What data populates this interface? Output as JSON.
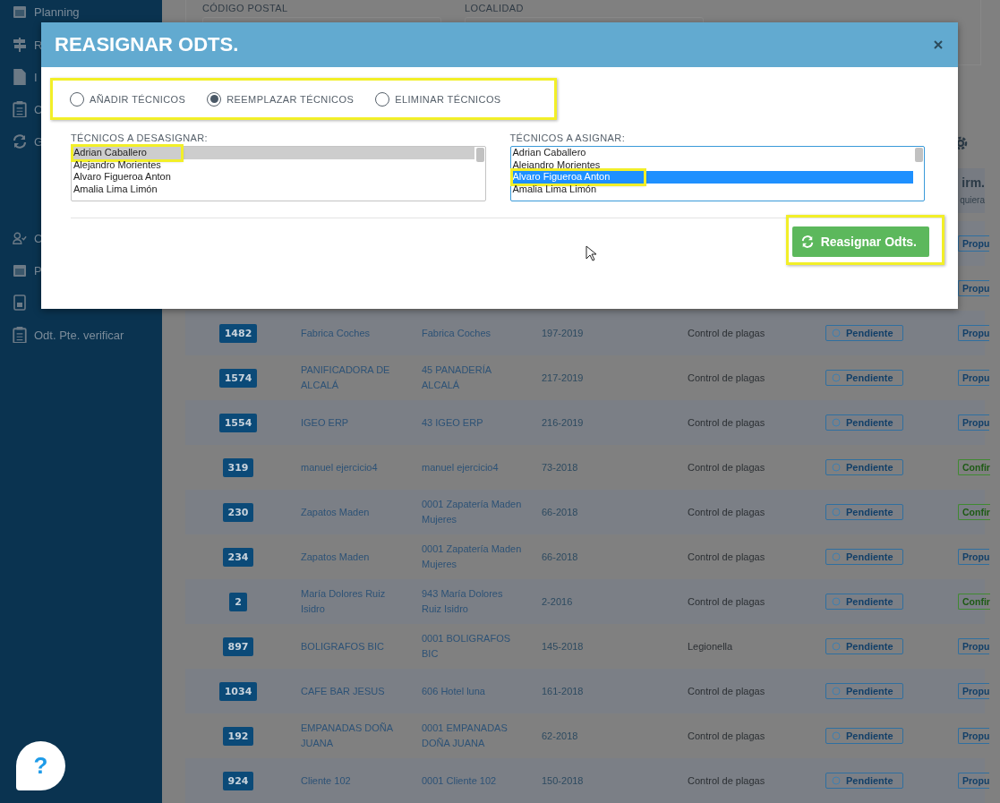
{
  "sidebar": {
    "items": [
      {
        "label": "Planning"
      },
      {
        "label": "R"
      },
      {
        "label": "I"
      },
      {
        "label": "C"
      },
      {
        "label": "G"
      },
      {
        "label": "C"
      },
      {
        "label": "P"
      },
      {
        "label": "Odt. Pte. verificar"
      }
    ]
  },
  "filters": {
    "fields": [
      {
        "label": "CÓDIGO POSTAL"
      },
      {
        "label": "LOCALIDAD"
      }
    ]
  },
  "table": {
    "header": {
      "label": "irm.",
      "hint": "quiera"
    },
    "partial_rows": [
      {
        "tag": {
          "text": "Propu",
          "kind": "proposed"
        }
      },
      {
        "tag": {
          "text": "Propu",
          "kind": "proposed"
        }
      }
    ],
    "rows": [
      {
        "id": "1482",
        "client": "Fabrica Coches",
        "address": "Fabrica Coches",
        "number": "197-2019",
        "service": "Control de plagas",
        "status": "Pendiente",
        "tag": {
          "text": "Propu",
          "kind": "proposed"
        }
      },
      {
        "id": "1574",
        "client": "PANIFICADORA DE ALCALÁ",
        "address": "45 PANADERÍA ALCALÁ",
        "number": "217-2019",
        "service": "Control de plagas",
        "status": "Pendiente",
        "tag": {
          "text": "Propu",
          "kind": "proposed"
        }
      },
      {
        "id": "1554",
        "client": "IGEO ERP",
        "address": "43 IGEO ERP",
        "number": "216-2019",
        "service": "Control de plagas",
        "status": "Pendiente",
        "tag": {
          "text": "Propu",
          "kind": "proposed"
        }
      },
      {
        "id": "319",
        "client": "manuel ejercicio4",
        "address": "manuel ejercicio4",
        "number": "73-2018",
        "service": "Control de plagas",
        "status": "Pendiente",
        "tag": {
          "text": "Confir",
          "kind": "confirmed"
        }
      },
      {
        "id": "230",
        "client": "Zapatos Maden",
        "address": "0001 Zapatería Maden Mujeres",
        "number": "66-2018",
        "service": "Control de plagas",
        "status": "Pendiente",
        "tag": {
          "text": "Confir",
          "kind": "confirmed"
        }
      },
      {
        "id": "234",
        "client": "Zapatos Maden",
        "address": "0001 Zapatería Maden Mujeres",
        "number": "66-2018",
        "service": "Control de plagas",
        "status": "Pendiente",
        "tag": {
          "text": "Propu",
          "kind": "proposed"
        }
      },
      {
        "id": "2",
        "client": "María Dolores Ruiz Isidro",
        "address": "943 María Dolores Ruiz Isidro",
        "number": "2-2016",
        "service": "Control de plagas",
        "status": "Pendiente",
        "tag": {
          "text": "Confir",
          "kind": "confirmed"
        }
      },
      {
        "id": "897",
        "client": "BOLIGRAFOS BIC",
        "address": "0001 BOLIGRAFOS BIC",
        "number": "145-2018",
        "service": "Legionella",
        "status": "Pendiente",
        "tag": {
          "text": "Propu",
          "kind": "proposed"
        }
      },
      {
        "id": "1034",
        "client": "CAFE BAR JESUS",
        "address": "606 Hotel luna",
        "number": "161-2018",
        "service": "Control de plagas",
        "status": "Pendiente",
        "tag": {
          "text": "Propu",
          "kind": "proposed"
        }
      },
      {
        "id": "192",
        "client": "EMPANADAS DOÑA JUANA",
        "address": "0001 EMPANADAS DOÑA JUANA",
        "number": "62-2018",
        "service": "Control de plagas",
        "status": "Pendiente",
        "tag": {
          "text": "Propu",
          "kind": "proposed"
        }
      },
      {
        "id": "924",
        "client": "Cliente 102",
        "address": "0001 Cliente 102",
        "number": "150-2018",
        "service": "Control de plagas",
        "status": "Pendiente",
        "tag": {
          "text": "Propu",
          "kind": "proposed"
        }
      }
    ]
  },
  "modal": {
    "title": "REASIGNAR ODTS.",
    "modes": [
      {
        "label": "AÑADIR TÉCNICOS",
        "selected": false
      },
      {
        "label": "REEMPLAZAR TÉCNICOS",
        "selected": true
      },
      {
        "label": "ELIMINAR TÉCNICOS",
        "selected": false
      }
    ],
    "lists": [
      {
        "label": "TÉCNICOS A DESASIGNAR:",
        "focused": false,
        "options": [
          {
            "text": "Adrian Caballero",
            "selected": true,
            "highlighted": true
          },
          {
            "text": "Alejandro Morientes",
            "selected": false,
            "highlighted": false
          },
          {
            "text": "Alvaro Figueroa Anton",
            "selected": false,
            "highlighted": false
          },
          {
            "text": "Amalia Lima Limón",
            "selected": false,
            "highlighted": false
          }
        ]
      },
      {
        "label": "TÉCNICOS A ASIGNAR:",
        "focused": true,
        "options": [
          {
            "text": "Adrian Caballero",
            "selected": false,
            "highlighted": false
          },
          {
            "text": "Alejandro Morientes",
            "selected": false,
            "highlighted": false
          },
          {
            "text": "Alvaro Figueroa Anton",
            "selected": true,
            "highlighted": true
          },
          {
            "text": "Amalia Lima Limón",
            "selected": false,
            "highlighted": false
          }
        ]
      }
    ],
    "submit": {
      "label": "Reasignar Odts."
    }
  },
  "help": {
    "label": "?"
  }
}
